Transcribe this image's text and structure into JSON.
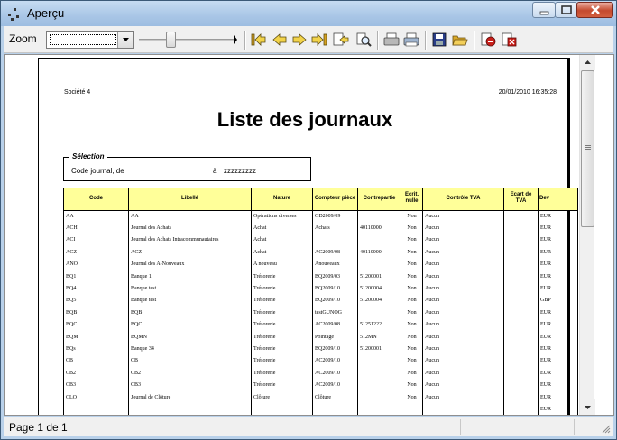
{
  "window": {
    "title": "Aperçu"
  },
  "toolbar": {
    "zoom_label": "Zoom",
    "zoom_value": ""
  },
  "report": {
    "company": "Société 4",
    "datetime": "20/01/2010 16:35:28",
    "title": "Liste des journaux",
    "selection": {
      "legend": "Sélection",
      "label": "Code journal, de",
      "to_word": "à",
      "to_value": "zzzzzzzzz"
    },
    "columns": [
      "Code",
      "Libellé",
      "Nature",
      "Compteur pièce",
      "Contrepartie",
      "Ecrit. nulle",
      "Contrôle TVA",
      "Ecart de TVA",
      "Dev"
    ],
    "rows": [
      [
        "AA",
        "AA",
        "Opérations diverses",
        "OD2009/09",
        "",
        "Non",
        "Aucun",
        "",
        "EUR"
      ],
      [
        "ACH",
        "Journal des Achats",
        "Achat",
        "Achats",
        "40110000",
        "Non",
        "Aucun",
        "",
        "EUR"
      ],
      [
        "ACI",
        "Journal des Achats Intracommunautaires",
        "Achat",
        "",
        "",
        "Non",
        "Aucun",
        "",
        "EUR"
      ],
      [
        "ACZ",
        "ACZ",
        "Achat",
        "AC2009/08",
        "40110000",
        "Non",
        "Aucun",
        "",
        "EUR"
      ],
      [
        "ANO",
        "Journal des A-Nouveaux",
        "A nouveau",
        "Anouveaux",
        "",
        "Non",
        "Aucun",
        "",
        "EUR"
      ],
      [
        "BQ1",
        "Banque 1",
        "Trésorerie",
        "BQ2009/03",
        "51200001",
        "Non",
        "Aucun",
        "",
        "EUR"
      ],
      [
        "BQ4",
        "Banque test",
        "Trésorerie",
        "BQ2009/10",
        "51200004",
        "Non",
        "Aucun",
        "",
        "EUR"
      ],
      [
        "BQ5",
        "Banque test",
        "Trésorerie",
        "BQ2009/10",
        "51200004",
        "Non",
        "Aucun",
        "",
        "GBP"
      ],
      [
        "BQB",
        "BQB",
        "Trésorerie",
        "testGUNOG",
        "",
        "Non",
        "Aucun",
        "",
        "EUR"
      ],
      [
        "BQC",
        "BQC",
        "Trésorerie",
        "AC2009/08",
        "51251222",
        "Non",
        "Aucun",
        "",
        "EUR"
      ],
      [
        "BQM",
        "BQMN",
        "Trésorerie",
        "Pointage",
        "512MN",
        "Non",
        "Aucun",
        "",
        "EUR"
      ],
      [
        "BQs",
        "Banque 34",
        "Trésorerie",
        "BQ2009/10",
        "51200001",
        "Non",
        "Aucun",
        "",
        "EUR"
      ],
      [
        "CB",
        "CB",
        "Trésorerie",
        "AC2009/10",
        "",
        "Non",
        "Aucun",
        "",
        "EUR"
      ],
      [
        "CB2",
        "CB2",
        "Trésorerie",
        "AC2009/10",
        "",
        "Non",
        "Aucun",
        "",
        "EUR"
      ],
      [
        "CB3",
        "CB3",
        "Trésorerie",
        "AC2009/10",
        "",
        "Non",
        "Aucun",
        "",
        "EUR"
      ],
      [
        "CLO",
        "Journal de Clôture",
        "Clôture",
        "Clôture",
        "",
        "Non",
        "Aucun",
        "",
        "EUR"
      ],
      [
        "",
        "",
        "",
        "",
        "",
        "",
        "",
        "",
        "EUR"
      ]
    ]
  },
  "status": {
    "page": "Page 1 de 1"
  }
}
